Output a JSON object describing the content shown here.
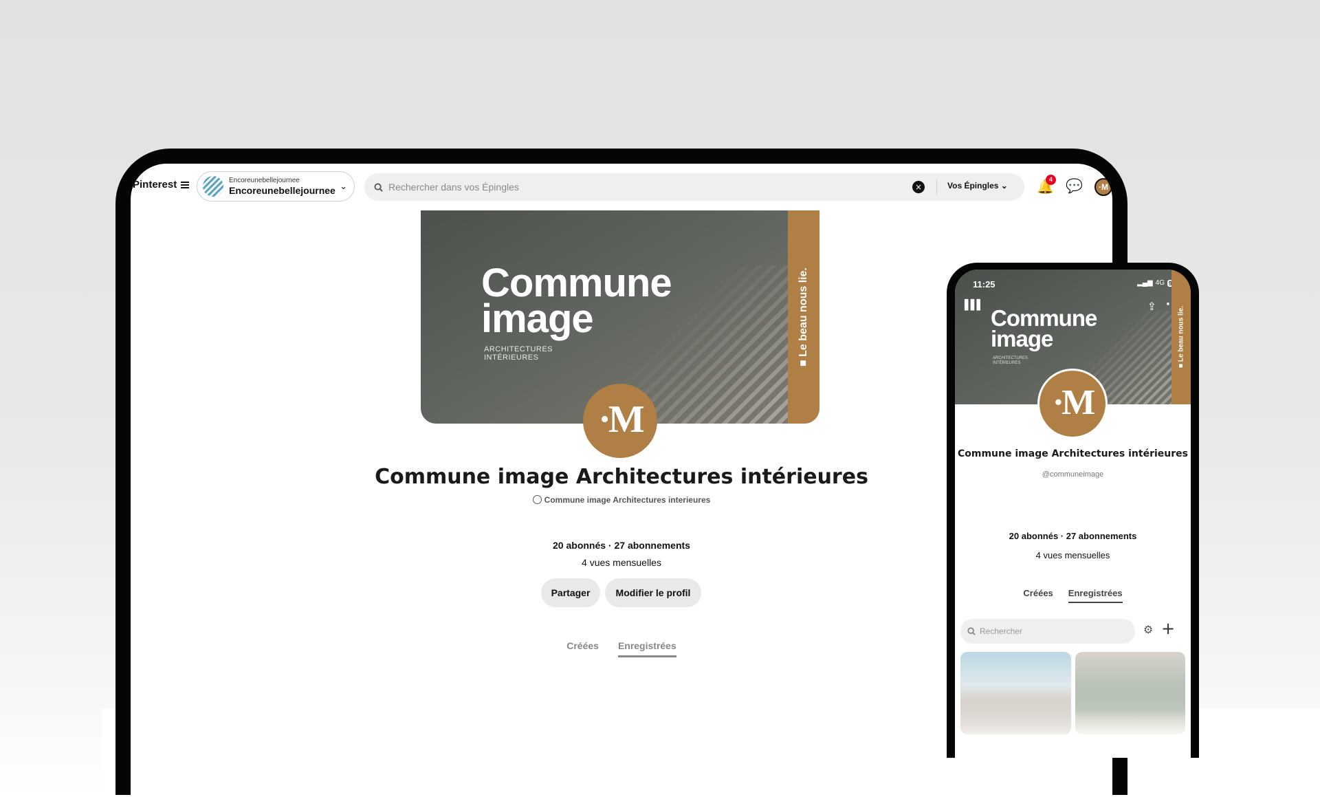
{
  "desktop": {
    "brand": "Pinterest",
    "account": {
      "small": "Encoreunebellejournee",
      "name": "Encoreunebellejournee"
    },
    "search": {
      "placeholder": "Rechercher dans vos Épingles"
    },
    "pins_menu": "Vos Épingles",
    "notifications_count": "4",
    "cover": {
      "title_line1": "Commune",
      "title_line2": "image",
      "sub_line1": "ARCHITECTURES",
      "sub_line2": "INTÉRIEURES",
      "band_text": "■ Le beau nous lie."
    },
    "profile": {
      "name": "Commune image Architectures intérieures",
      "handle": "Commune image Architectures interieures",
      "stats": "20 abonnés · 27 abonnements",
      "views": "4 vues mensuelles"
    },
    "buttons": {
      "share": "Partager",
      "edit": "Modifier le profil"
    },
    "tabs": [
      "Créées",
      "Enregistrées"
    ],
    "active_tab": "Enregistrées",
    "colors": {
      "accent": "#b07f45",
      "badge": "#e60023"
    }
  },
  "mobile": {
    "time": "11:25",
    "network": "4G",
    "battery": "90",
    "cover": {
      "title_line1": "Commune",
      "title_line2": "image",
      "sub_line1": "ARCHITECTURES",
      "sub_line2": "INTÉRIEURES",
      "band_text": "■ Le beau nous lie."
    },
    "profile": {
      "name": "Commune image Architectures intérieures",
      "handle": "@communeimage",
      "stats": "20 abonnés · 27 abonnements",
      "views": "4 vues mensuelles"
    },
    "tabs": [
      "Créées",
      "Enregistrées"
    ],
    "active_tab": "Enregistrées",
    "search": {
      "placeholder": "Rechercher"
    }
  }
}
